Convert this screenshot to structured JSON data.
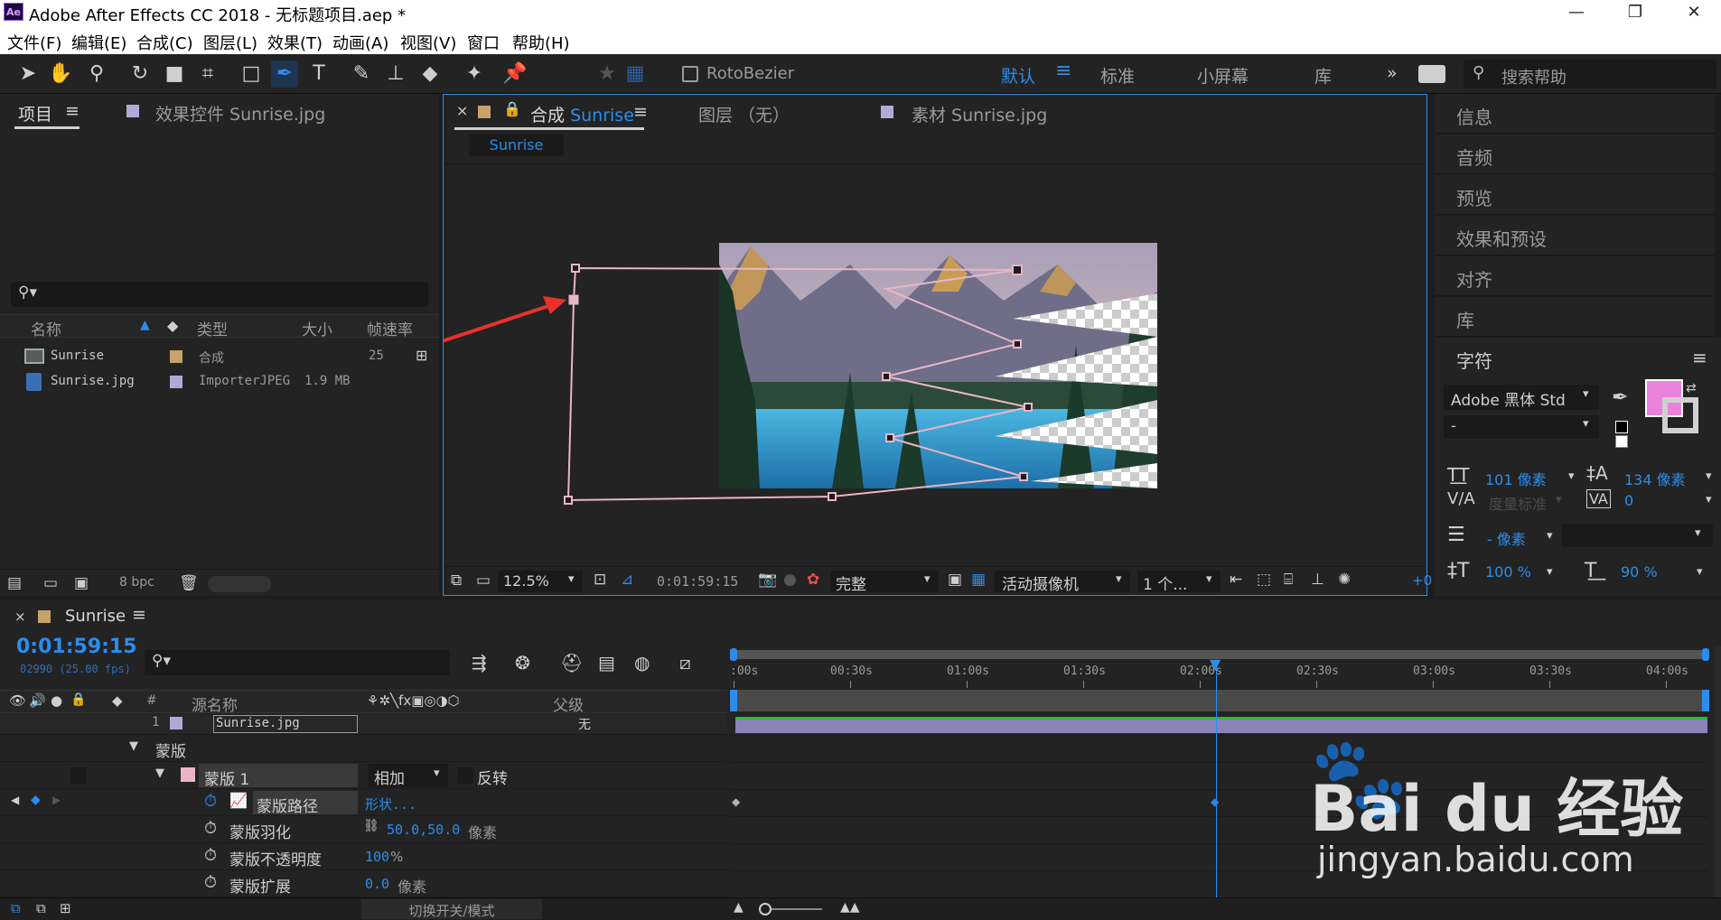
{
  "app": {
    "title": "Adobe After Effects CC 2018 - 无标题项目.aep *",
    "logo": "Ae"
  },
  "window_controls": {
    "minimize": "—",
    "maximize": "❐",
    "close": "✕"
  },
  "menu": [
    "文件(F)",
    "编辑(E)",
    "合成(C)",
    "图层(L)",
    "效果(T)",
    "动画(A)",
    "视图(V)",
    "窗口",
    "帮助(H)"
  ],
  "toolbar": {
    "rotobezier": "RotoBezier",
    "workspaces": [
      "默认",
      "标准",
      "小屏幕",
      "库"
    ],
    "more": "»",
    "search_placeholder": "搜索帮助"
  },
  "project_panel": {
    "tab_project": "项目",
    "tab_effects": "效果控件 Sunrise.jpg",
    "search_placeholder": "",
    "columns": [
      "名称",
      "类型",
      "大小",
      "帧速率"
    ],
    "items": [
      {
        "name": "Sunrise",
        "type": "合成",
        "size": "",
        "fps": "25",
        "label_color": "#c6a36b"
      },
      {
        "name": "Sunrise.jpg",
        "type": "ImporterJPEG",
        "size": "1.9 MB",
        "fps": "",
        "label_color": "#b4a9d6"
      }
    ],
    "bpc": "8 bpc"
  },
  "comp_panel": {
    "tab_comp_prefix": "合成",
    "tab_comp_name": "Sunrise",
    "tab_layer": "图层 （无）",
    "tab_footage": "素材 Sunrise.jpg",
    "breadcrumb": "Sunrise",
    "zoom": "12.5%",
    "timecode": "0:01:59:15",
    "quality": "完整",
    "camera": "活动摄像机",
    "views": "1 个...",
    "offset": "+0"
  },
  "right_panel": {
    "items": [
      "信息",
      "音频",
      "预览",
      "效果和预设",
      "对齐",
      "库"
    ],
    "character": {
      "title": "字符",
      "font": "Adobe 黑体 Std",
      "style": "-",
      "font_size": "101 像素",
      "leading": "134 像素",
      "kerning": "度量标准",
      "tracking": "0",
      "stroke": "- 像素",
      "vscale": "100 %",
      "hscale": "90 %",
      "fill_color": "#ea82dc"
    }
  },
  "timeline": {
    "comp_name": "Sunrise",
    "timecode": "0:01:59:15",
    "frame_info": "02990 (25.00 fps)",
    "ruler": [
      ":00s",
      "00:30s",
      "01:00s",
      "01:30s",
      "02:00s",
      "02:30s",
      "03:00s",
      "03:30s",
      "04:00s"
    ],
    "playhead_fraction": 0.497,
    "col_source": "源名称",
    "col_parent": "父级",
    "col_num": "#",
    "layer": {
      "index": "1",
      "name": "Sunrise.jpg",
      "parent": "无"
    },
    "mask_group": "蒙版",
    "mask": {
      "name": "蒙版 1",
      "mode": "相加",
      "invert": "反转"
    },
    "props": [
      {
        "label": "蒙版路径",
        "value": "形状..."
      },
      {
        "label": "蒙版羽化",
        "value": "50.0,50.0",
        "unit": "像素"
      },
      {
        "label": "蒙版不透明度",
        "value": "100",
        "unit": "%"
      },
      {
        "label": "蒙版扩展",
        "value": "0.0",
        "unit": "像素"
      }
    ],
    "switch_modes": "切换开关/模式"
  },
  "watermark": {
    "brand": "Bai du 经验",
    "url": "jingyan.baidu.com"
  },
  "colors": {
    "accent": "#2d8ceb",
    "mask": "#e8b6c6",
    "layer_bar": "#8a82b8",
    "arrow": "#e8322a"
  }
}
